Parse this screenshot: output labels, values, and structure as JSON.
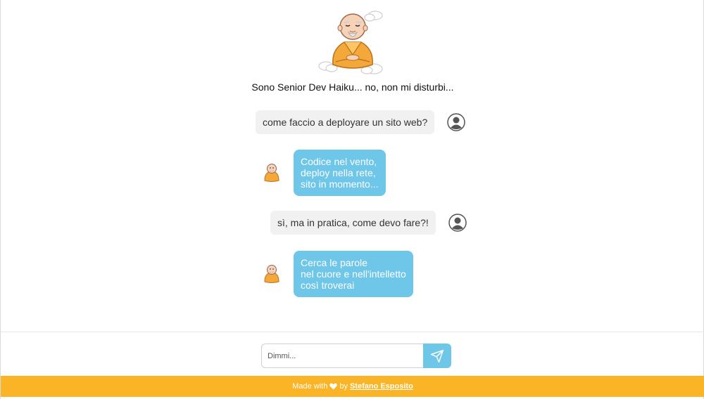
{
  "header": {
    "tagline": "Sono Senior Dev Haiku... no, non mi disturbi..."
  },
  "messages": [
    {
      "from": "user",
      "text": "come faccio a deployare un sito web?"
    },
    {
      "from": "bot",
      "text": "Codice nel vento,\ndeploy nella rete,\nsito in momento..."
    },
    {
      "from": "user",
      "text": "sì, ma in pratica, come devo fare?!"
    },
    {
      "from": "bot",
      "text": "Cerca le parole\nnel cuore e nell'intelletto\ncosì troverai"
    }
  ],
  "composer": {
    "placeholder": "Dimmi..."
  },
  "credit": {
    "prefix": "Made with",
    "by": "by",
    "author": "Stefano Esposito"
  },
  "colors": {
    "accent": "#6ec6e8",
    "footer": "#fbb425",
    "user_bubble": "#f1f1f1"
  }
}
